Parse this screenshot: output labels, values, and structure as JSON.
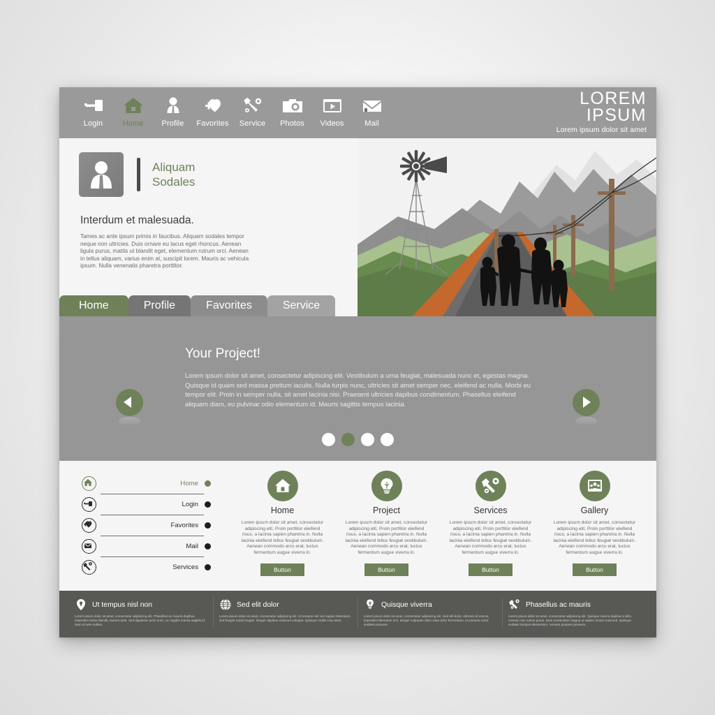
{
  "header": {
    "nav": [
      {
        "label": "Login",
        "icon": "key-icon",
        "active": false
      },
      {
        "label": "Home",
        "icon": "house-icon",
        "active": true
      },
      {
        "label": "Profile",
        "icon": "person-icon",
        "active": false
      },
      {
        "label": "Favorites",
        "icon": "heart-plus-icon",
        "active": false
      },
      {
        "label": "Service",
        "icon": "wrench-gear-icon",
        "active": false
      },
      {
        "label": "Photos",
        "icon": "camera-icon",
        "active": false
      },
      {
        "label": "Videos",
        "icon": "video-player-icon",
        "active": false
      },
      {
        "label": "Mail",
        "icon": "envelope-icon",
        "active": false
      }
    ],
    "brand_line1": "LOREM",
    "brand_line2": "IPSUM",
    "brand_tagline": "Lorem ipsum dolor sit amet"
  },
  "intro": {
    "avatar_icon": "person-avatar-icon",
    "name_line1": "Aliquam",
    "name_line2": "Sodales",
    "heading": "Interdum et malesuada.",
    "body": "Tames ac ante ipsum primis in faucibus. Aliquam sodales tempor neque non ultricies. Duis ornare eu lacus eget rhoncus. Aenean ligula purus, mattis ut blandit eget, elementum rutrum orci. Aenean in tellus aliquam, varius enim at, suscipit lorem. Mauris ac vehicula ipsum. Nulla venenatis pharetra porttitor."
  },
  "tabs": [
    {
      "label": "Home",
      "active": true
    },
    {
      "label": "Profile",
      "active": false
    },
    {
      "label": "Favorites",
      "active": false
    },
    {
      "label": "Service",
      "active": false
    }
  ],
  "slider": {
    "title": "Your Project!",
    "body": "Lorem ipsum dolor sit amet, consectetur adipiscing elit. Vestibulum a urna feugiat, malesuada nunc et, egestas magna. Quisque id quam sed massa pretium iaculis. Nulla turpis nunc, ultricies sit amet semper nec, eleifend ac nulla. Morbi eu tempor elit. Proin in semper nulla, sit amet lacinia nisi. Praesent ultricies dapibus condimentum. Phasellus eleifend aliquam diam, eu pulvinar odio elementum id. Mauris sagittis tempus lacinia.",
    "prev_icon": "chevron-left-icon",
    "next_icon": "chevron-right-icon",
    "dots": [
      {
        "active": false
      },
      {
        "active": true
      },
      {
        "active": false
      },
      {
        "active": false
      }
    ]
  },
  "sidelist": [
    {
      "label": "Home",
      "icon": "house-icon",
      "active": true
    },
    {
      "label": "Login",
      "icon": "key-icon",
      "active": false
    },
    {
      "label": "Favorites",
      "icon": "heart-plus-icon",
      "active": false
    },
    {
      "label": "Mail",
      "icon": "envelope-icon",
      "active": false
    },
    {
      "label": "Services",
      "icon": "wrench-gear-icon",
      "active": false
    }
  ],
  "cards": [
    {
      "title": "Home",
      "icon": "house-icon",
      "body": "Lorem ipsum dolor sit amet, consectetur adipiscing elit. Proin porttitor eleifend risus, a lacinia sapien pharetra in. Nulla lacinia eleifend tellus feugiat vestibulum. Aenean commodo arcu erat, luctus fermentum augue viverra in.",
      "button": "Button"
    },
    {
      "title": "Project",
      "icon": "lightbulb-icon",
      "body": "Lorem ipsum dolor sit amet, consectetur adipiscing elit. Proin porttitor eleifend risus, a lacinia sapien pharetra in. Nulla lacinia eleifend tellus feugiat vestibulum. Aenean commodo arcu erat, luctus fermentum augue viverra in.",
      "button": "Button"
    },
    {
      "title": "Services",
      "icon": "wrench-gear-icon",
      "body": "Lorem ipsum dolor sit amet, consectetur adipiscing elit. Proin porttitor eleifend risus, a lacinia sapien pharetra in. Nulla lacinia eleifend tellus feugiat vestibulum. Aenean commodo arcu erat, luctus fermentum augue viverra in.",
      "button": "Button"
    },
    {
      "title": "Gallery",
      "icon": "gallery-icon",
      "body": "Lorem ipsum dolor sit amet, consectetur adipiscing elit. Proin porttitor eleifend risus, a lacinia sapien pharetra in. Nulla lacinia eleifend tellus feugiat vestibulum. Aenean commodo arcu erat, luctus fermentum augue viverra in.",
      "button": "Button"
    }
  ],
  "footer": [
    {
      "title": "Ut tempus nisl non",
      "icon": "location-pin-icon",
      "body": "Lorem ipsum dolor sit amet, consectetur adipiscing elit. Phasellus ac mauris dapibus, imperdiet metus blandit, laoreet ante. Sed dignissim justo enim, ac sagittis massa sagittis id. Nam id sem nullam."
    },
    {
      "title": "Sed elit dolor",
      "icon": "globe-icon",
      "body": "Lorem ipsum dolor sit amet, consectetur adipiscing elit. Ut tempus nisl non sapien bibendum, sed feugiat turpis feugiat. Integer dapibus euismod volutpat. Quisque mollis cras amet."
    },
    {
      "title": "Quisque viverra",
      "icon": "lightbulb-icon",
      "body": "Lorem ipsum dolor sit amet, consectetur adipiscing elit. Sed elit dolor, ultricies sit erat at, imperdiet bibendum orci. Integer vulputate diam vitae dolor fermentum, id posuere tortor sodales posuere."
    },
    {
      "title": "Phasellus ac mauris",
      "icon": "wrench-gear-icon",
      "body": "Lorem ipsum dolor sit amet, consectetur adipiscing elit. Quisque viverra dapibus mollis. Aenean non varius purus. Duis consectetur magna ut sapien ornare euismod. Quisque sodales tempus elementum. Aenean posuere posuere."
    }
  ],
  "colors": {
    "green": "#6e8159",
    "header_gray": "#9a9a9a",
    "slider_gray": "#969696",
    "footer_gray": "#585855",
    "page_bg": "#f5f5f5"
  }
}
